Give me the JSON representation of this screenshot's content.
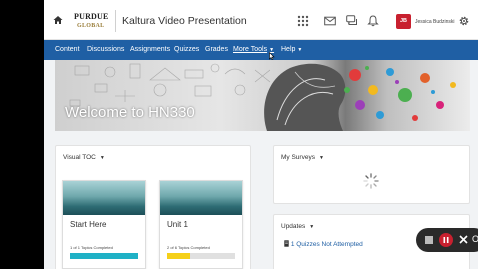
{
  "header": {
    "logo_top": "PURDUE",
    "logo_bottom": "GLOBAL",
    "course_title": "Kaltura Video Presentation",
    "avatar_initials": "JB",
    "user_name": "Jessica Budzinski",
    "icons": [
      "home-icon",
      "grid-icon",
      "mail-icon",
      "chat-icon",
      "bell-icon",
      "gear-icon"
    ]
  },
  "nav": {
    "items": [
      {
        "label": "Content"
      },
      {
        "label": "Discussions"
      },
      {
        "label": "Assignments"
      },
      {
        "label": "Quizzes"
      },
      {
        "label": "Grades"
      },
      {
        "label": "More Tools"
      },
      {
        "label": "Help"
      }
    ],
    "color": "#1f5fa4"
  },
  "banner": {
    "title": "Welcome to HN330"
  },
  "visual_toc": {
    "heading": "Visual TOC",
    "tiles": [
      {
        "title": "Start Here",
        "progress": "1 of 1 Topics Completed",
        "fraction": 1.0,
        "color": "#1fb1c6"
      },
      {
        "title": "Unit 1",
        "progress": "2 of 6 Topics Completed",
        "fraction": 0.333,
        "color": "#f5d019"
      }
    ]
  },
  "my_surveys": {
    "heading": "My Surveys"
  },
  "updates": {
    "heading": "Updates",
    "count": "1",
    "link_text": "Quizzes Not Attempted"
  },
  "recorder": {
    "partial_label": "O"
  }
}
